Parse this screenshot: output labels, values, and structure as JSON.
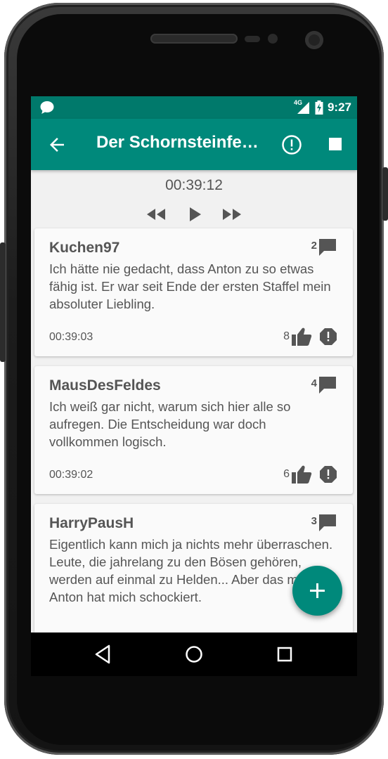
{
  "status_bar": {
    "network": "4G",
    "time": "9:27"
  },
  "toolbar": {
    "title": "Der Schornsteinfe…"
  },
  "player": {
    "time": "00:39:12"
  },
  "comments": [
    {
      "user": "Kuchen97",
      "replies": "2",
      "text": "Ich hätte nie gedacht, dass Anton zu so etwas fähig ist. Er war seit Ende der ersten Staffel mein absoluter Liebling.",
      "timestamp": "00:39:03",
      "likes": "8"
    },
    {
      "user": "MausDesFeldes",
      "replies": "4",
      "text": "Ich weiß gar nicht, warum sich hier alle so aufregen. Die Entscheidung war doch vollkommen logisch.",
      "timestamp": "00:39:02",
      "likes": "6"
    },
    {
      "user": "HarryPausH",
      "replies": "3",
      "text": "Eigentlich kann mich ja nichts mehr überraschen. Leute, die jahrelang zu den Bösen gehören, werden auf einmal zu Helden... Aber das mit Anton hat mich schockiert.",
      "timestamp": "",
      "likes": ""
    }
  ],
  "fab": {
    "icon": "add-icon"
  },
  "colors": {
    "primary": "#00897b",
    "primary_dark": "#00796b",
    "card_bg": "#fafafa",
    "content_bg": "#f1f1f1",
    "text": "#555555"
  }
}
